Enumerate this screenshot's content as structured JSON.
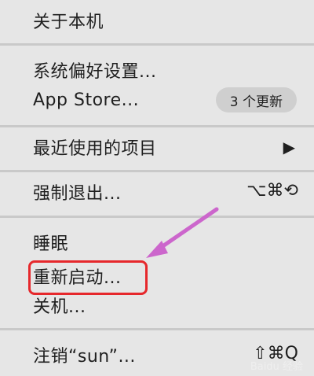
{
  "menu": {
    "about": "关于本机",
    "system_prefs": "系统偏好设置...",
    "app_store": "App Store...",
    "app_store_badge": "3 个更新",
    "recent_items": "最近使用的项目",
    "recent_arrow": "▶",
    "force_quit": "强制退出...",
    "force_quit_shortcut": "⌥⌘⟲",
    "sleep": "睡眠",
    "restart": "重新启动...",
    "shutdown": "关机...",
    "logout": "注销“sun”...",
    "logout_shortcut": "⇧⌘Q"
  },
  "watermark": {
    "text": "Baidu 经验"
  },
  "colors": {
    "menu_bg": "#e6e6e6",
    "separator": "#c9c9c9",
    "badge_bg": "#cfcfcf",
    "highlight": "#e6282c",
    "annotation_arrow": "#cc66cc"
  }
}
